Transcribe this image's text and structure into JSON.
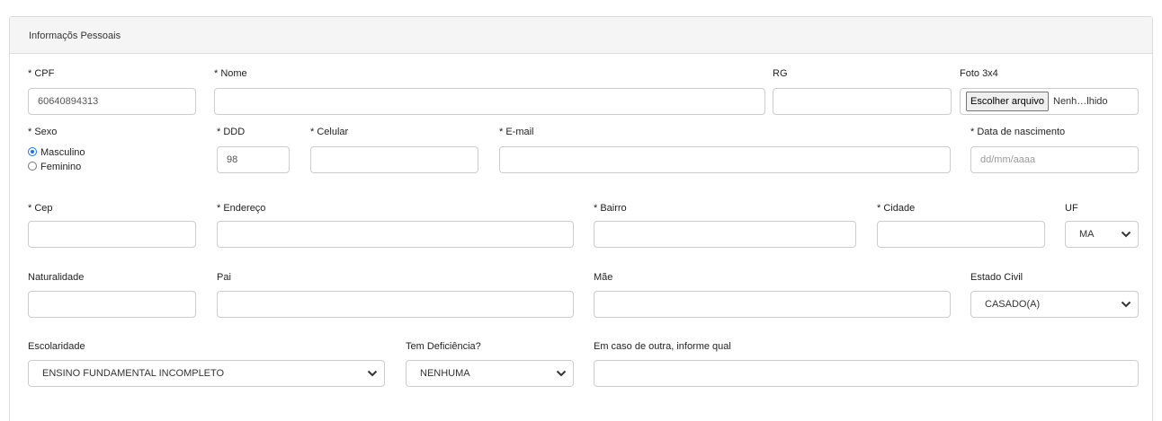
{
  "panel": {
    "title": "Informaçõs Pessoais"
  },
  "labels": {
    "cpf": "* CPF",
    "nome": "* Nome",
    "rg": "RG",
    "foto": "Foto 3x4",
    "sexo": "* Sexo",
    "ddd": "* DDD",
    "celular": "* Celular",
    "email": "* E-mail",
    "nascimento": "* Data de nascimento",
    "cep": "* Cep",
    "endereco": "* Endereço",
    "bairro": "* Bairro",
    "cidade": "* Cidade",
    "uf": "UF",
    "naturalidade": "Naturalidade",
    "pai": "Pai",
    "mae": "Mãe",
    "estado_civil": "Estado Civil",
    "escolaridade": "Escolaridade",
    "deficiencia": "Tem Deficiência?",
    "outra": "Em caso de outra, informe qual"
  },
  "values": {
    "cpf": "60640894313",
    "ddd": "98",
    "nascimento_placeholder": "dd/mm/aaaa",
    "uf": "MA",
    "estado_civil": "CASADO(A)",
    "escolaridade": "ENSINO FUNDAMENTAL INCOMPLETO",
    "deficiencia": "NENHUMA"
  },
  "file_input": {
    "button": "Escolher arquivo",
    "status": "Nenh…lhido"
  },
  "sexo_options": [
    {
      "label": "Masculino",
      "checked": true
    },
    {
      "label": "Feminino",
      "checked": false
    }
  ],
  "icons": {
    "select_chevron": "chevron-down-icon",
    "radio": "radio-icon"
  },
  "colors": {
    "radio_accent": "#1a73e8",
    "panel_heading": "#f5f5f5",
    "border": "#cccccc"
  }
}
